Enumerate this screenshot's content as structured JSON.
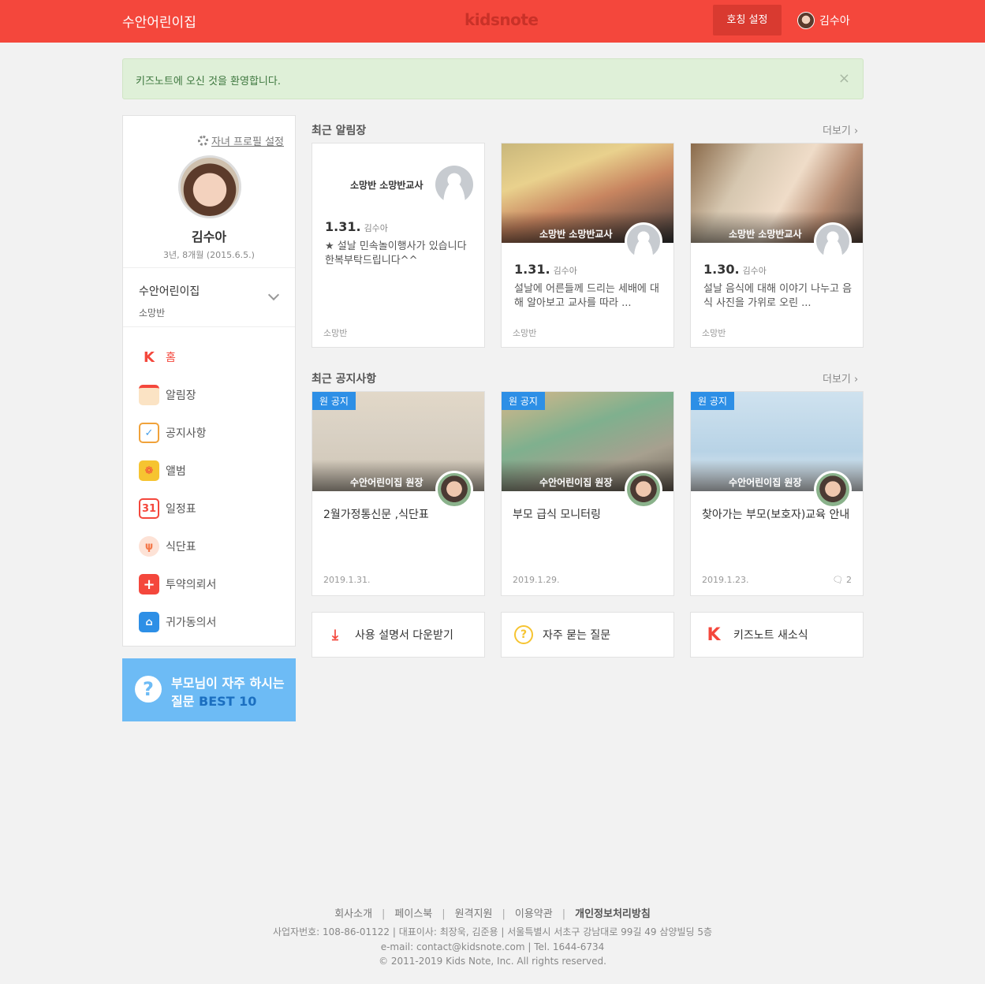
{
  "header": {
    "title": "수안어린이집",
    "logo": "kidsnote",
    "nickname_button": "호칭 설정",
    "user": "김수아"
  },
  "alert": {
    "text": "키즈노트에 오신 것을 환영합니다.",
    "close": "×"
  },
  "sidebar": {
    "profile_link": "자녀 프로필 설정",
    "child_name": "김수아",
    "child_age": "3년, 8개월 (2015.6.5.)",
    "school": "수안어린이집",
    "class": "소망반",
    "menu": [
      {
        "label": "홈",
        "icon": "home-k-icon",
        "color": "#f4473c"
      },
      {
        "label": "알림장",
        "icon": "notebook-icon",
        "color": "#f0a23a"
      },
      {
        "label": "공지사항",
        "icon": "checklist-icon",
        "color": "#4aa0e8"
      },
      {
        "label": "앨범",
        "icon": "album-icon",
        "color": "#f6c431"
      },
      {
        "label": "일정표",
        "icon": "calendar-31-icon",
        "color": "#f4473c"
      },
      {
        "label": "식단표",
        "icon": "fork-knife-icon",
        "color": "#f47a4c"
      },
      {
        "label": "투약의뢰서",
        "icon": "medicine-plus-icon",
        "color": "#f4473c"
      },
      {
        "label": "귀가동의서",
        "icon": "home-return-icon",
        "color": "#2d8fe6"
      }
    ],
    "faq": {
      "line1": "부모님이 자주 하시는",
      "line2_a": "질문 ",
      "line2_b": "BEST 10"
    }
  },
  "notes_section": {
    "title": "최근 알림장",
    "more": "더보기",
    "cards": [
      {
        "teacher": "소망반 소망반교사",
        "date": "1.31.",
        "author": "김수아",
        "body": "★ 설날 민속놀이행사가 있습니다 한복부탁드립니다^^",
        "class": "소망반"
      },
      {
        "teacher": "소망반 소망반교사",
        "date": "1.31.",
        "author": "김수아",
        "body": "설날에 어른들께 드리는 세배에 대해 알아보고 교사를 따라 ...",
        "class": "소망반"
      },
      {
        "teacher": "소망반 소망반교사",
        "date": "1.30.",
        "author": "김수아",
        "body": "설날 음식에 대해 이야기 나누고 음식 사진을 가위로 오린 ...",
        "class": "소망반"
      }
    ]
  },
  "notice_section": {
    "title": "최근 공지사항",
    "more": "더보기",
    "cards": [
      {
        "badge": "원 공지",
        "teacher": "수안어린이집 원장",
        "title": "2월가정통신문 ,식단표",
        "date": "2019.1.31.",
        "comments": ""
      },
      {
        "badge": "원 공지",
        "teacher": "수안어린이집 원장",
        "title": "부모 급식 모니터링",
        "date": "2019.1.29.",
        "comments": ""
      },
      {
        "badge": "원 공지",
        "teacher": "수안어린이집 원장",
        "title": "찾아가는 부모(보호자)교육 안내",
        "date": "2019.1.23.",
        "comments": "2"
      }
    ]
  },
  "links": [
    {
      "label": "사용 설명서 다운받기",
      "icon": "download-icon"
    },
    {
      "label": "자주 묻는 질문",
      "icon": "question-circle-icon"
    },
    {
      "label": "키즈노트 새소식",
      "icon": "kidsnote-k-icon"
    }
  ],
  "footer": {
    "links": [
      "회사소개",
      "페이스북",
      "원격지원",
      "이용약관",
      "개인정보처리방침"
    ],
    "line1": "사업자번호: 108-86-01122 |   대표이사: 최장욱, 김준용  |   서울특별시 서초구 강남대로 99길 49 삼양빌딩 5층",
    "line2": "e-mail: contact@kidsnote.com  |  Tel. 1644-6734",
    "line3": "© 2011-2019 Kids Note, Inc. All rights reserved."
  }
}
